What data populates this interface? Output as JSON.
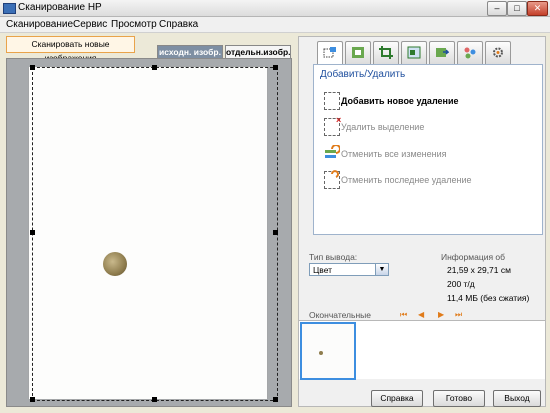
{
  "window": {
    "title": "Сканирование HP",
    "minimize": "–",
    "maximize": "□",
    "close": "✕"
  },
  "menu": [
    "Сканирование",
    "Сервис",
    "Просмотр",
    "Справка"
  ],
  "scan_new_label": "Сканировать новые изображения",
  "tabs": [
    "исходн. изобр.",
    "отдельн.изобр."
  ],
  "tool_icons": [
    "add-remove-icon",
    "color-icon",
    "crop-icon",
    "resize-icon",
    "rotate-icon",
    "adjust-icon",
    "gear-icon"
  ],
  "edit": {
    "title": "Добавить/Удалить",
    "actions": [
      {
        "label": "Добавить новое удаление",
        "enabled": true
      },
      {
        "label": "Удалить выделение",
        "enabled": false
      },
      {
        "label": "Отменить все изменения",
        "enabled": false
      },
      {
        "label": "Отменить последнее удаление",
        "enabled": false
      }
    ]
  },
  "output": {
    "label": "Тип вывода:",
    "value": "Цвет"
  },
  "info": {
    "label": "Информация об",
    "size": "21,59 х 29,71 см",
    "dpi": "200 т/д",
    "file_size": "11,4 МБ (без сжатия)"
  },
  "final_label": "Окончательные",
  "nav": [
    "⏮",
    "◀",
    "▶",
    "⏭"
  ],
  "buttons": {
    "help": "Справка",
    "done": "Готово",
    "exit": "Выход"
  },
  "colors": {
    "accent": "#3d8ee0",
    "edit_title": "#1f4f9e",
    "nav_arrow": "#e07b1a",
    "tab_active": "#7e8fa3"
  }
}
